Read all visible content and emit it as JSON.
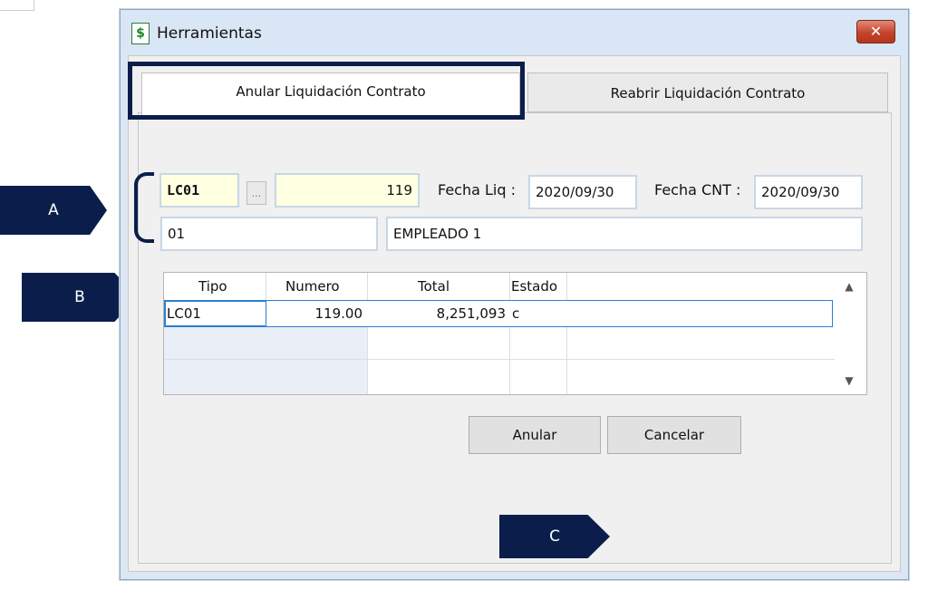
{
  "window": {
    "title": "Herramientas",
    "icon": "dollar-doc-icon",
    "close_label": "✕"
  },
  "tabs": [
    {
      "label": "Anular Liquidación Contrato",
      "active": true
    },
    {
      "label": "Reabrir Liquidación Contrato",
      "active": false
    }
  ],
  "form": {
    "tipo_value": "LC01",
    "browse_label": "...",
    "numero_value": "119",
    "fecha_liq_label": "Fecha Liq :",
    "fecha_liq_value": "2020/09/30",
    "fecha_cnt_label": "Fecha CNT :",
    "fecha_cnt_value": "2020/09/30",
    "employee_code": "01",
    "employee_name": "EMPLEADO 1"
  },
  "grid": {
    "columns": [
      "Tipo",
      "Numero",
      "Total",
      "Estado"
    ],
    "rows": [
      {
        "tipo": "LC01",
        "numero": "119.00",
        "total": "8,251,093",
        "estado": "c"
      }
    ]
  },
  "buttons": {
    "anular": "Anular",
    "cancelar": "Cancelar"
  },
  "annotations": {
    "a": "A",
    "b": "B",
    "c": "C"
  },
  "colors": {
    "annotation_navy": "#0b1e4b",
    "input_yellow": "#ffffe1",
    "close_red": "#c4432b"
  }
}
